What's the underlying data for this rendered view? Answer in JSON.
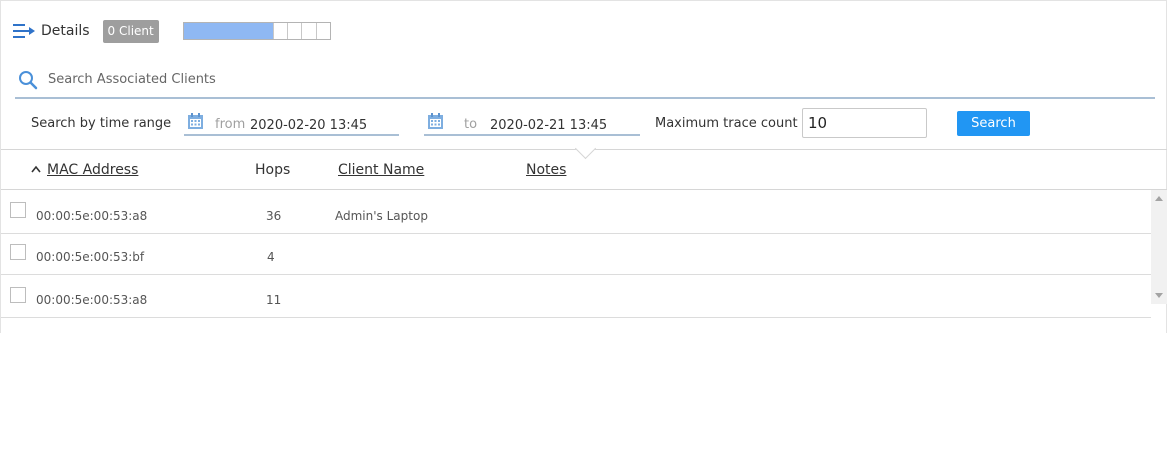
{
  "header": {
    "title": "Details",
    "client_badge": "0 Client",
    "progress_fraction": 0.6
  },
  "search": {
    "placeholder": "Search Associated Clients",
    "value": ""
  },
  "time_range": {
    "label": "Search by time range",
    "from_prefix": "from",
    "from_value": "2020-02-20 13:45",
    "to_prefix": "to",
    "to_value": "2020-02-21 13:45",
    "trace_label": "Maximum trace count",
    "trace_value": "10",
    "search_button": "Search"
  },
  "table": {
    "columns": {
      "mac": "MAC Address",
      "hops": "Hops",
      "client_name": "Client Name",
      "notes": "Notes"
    },
    "rows": [
      {
        "mac": "00:00:5e:00:53:a8",
        "hops": "36",
        "client_name": "Admin's Laptop",
        "notes": ""
      },
      {
        "mac": "00:00:5e:00:53:bf",
        "hops": "4",
        "client_name": "",
        "notes": ""
      },
      {
        "mac": "00:00:5e:00:53:a8",
        "hops": "11",
        "client_name": "",
        "notes": ""
      }
    ]
  },
  "icons": {
    "details": "list-arrow-icon",
    "search": "search-icon",
    "calendar": "calendar-icon",
    "sort": "sort-ascending-icon"
  },
  "colors": {
    "accent": "#2196f3",
    "progress_fill": "#8fb8f3",
    "badge": "#9e9e9e",
    "underline": "#a9bfd5"
  }
}
